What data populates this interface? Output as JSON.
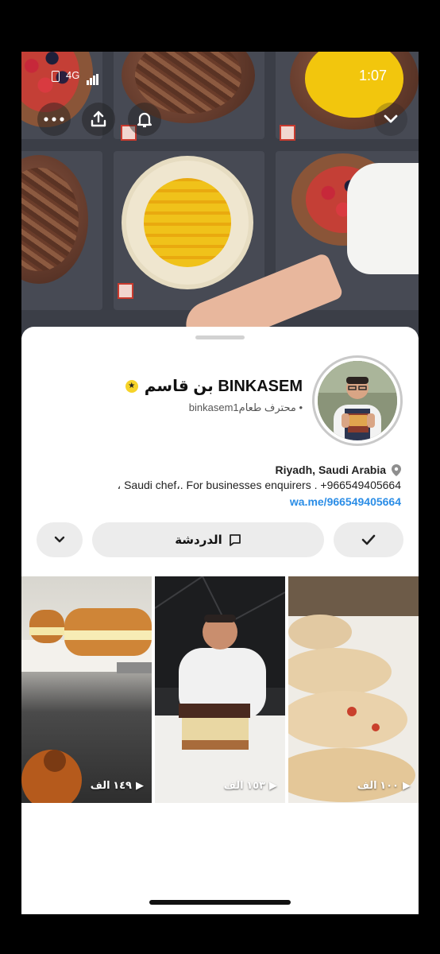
{
  "status_bar": {
    "network": "4G",
    "time": "1:07"
  },
  "profile": {
    "display_name": "بن قاسم BINKASEM",
    "subtitle": "binkasem1محترف طعام •",
    "location": "Riyadh, Saudi Arabia",
    "bio": "، Saudi chef،. For businesses enquirers . +966549405664",
    "link": "wa.me/966549405664"
  },
  "actions": {
    "chat_label": "الدردشة"
  },
  "thumbnails": [
    {
      "views": "١٤٩ الف"
    },
    {
      "views": "١٥٣ الف"
    },
    {
      "views": "١٠٠ الف"
    }
  ],
  "colors": {
    "link": "#2b8de6",
    "badge": "#f6d329",
    "pill": "#ececec"
  }
}
